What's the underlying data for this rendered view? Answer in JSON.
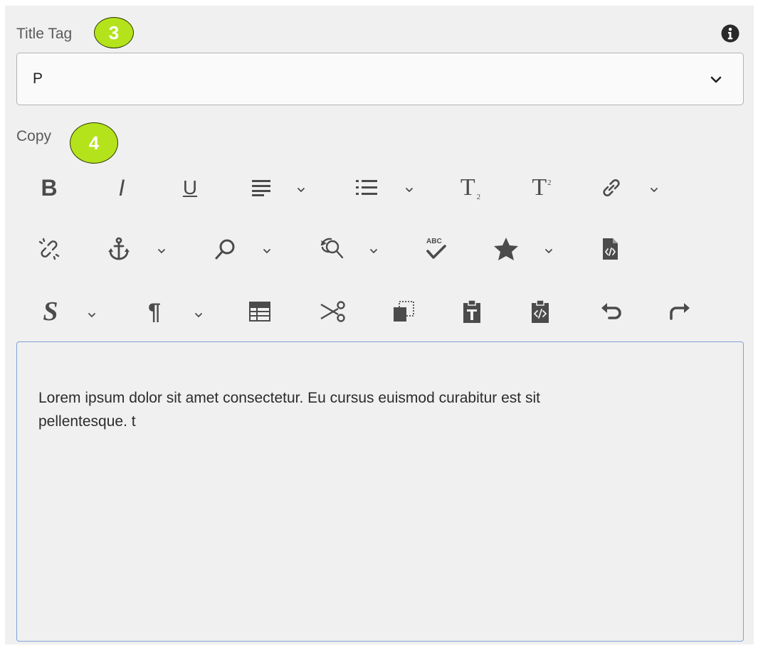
{
  "title_tag": {
    "label": "Title Tag",
    "badge": "3",
    "selected_value": "P",
    "icons": {
      "info": "info-circle-icon",
      "chevron": "chevron-down-icon"
    }
  },
  "copy": {
    "label": "Copy",
    "badge": "4"
  },
  "toolbar": {
    "bold": "B",
    "italic": "I",
    "underline": "U",
    "subscript": "T",
    "subscript_mark": "2",
    "superscript": "T",
    "superscript_mark": "2",
    "spellcheck_label": "ABC",
    "styles": "S",
    "paragraph": "¶"
  },
  "editor": {
    "content": "Lorem ipsum dolor sit amet consectetur. Eu cursus euismod curabitur est sit pellentesque. t"
  },
  "colors": {
    "badge": "#b4e31c",
    "panel": "#f0f0f0",
    "icon": "#4b4b4b",
    "editor_border": "#7fa3d6"
  }
}
